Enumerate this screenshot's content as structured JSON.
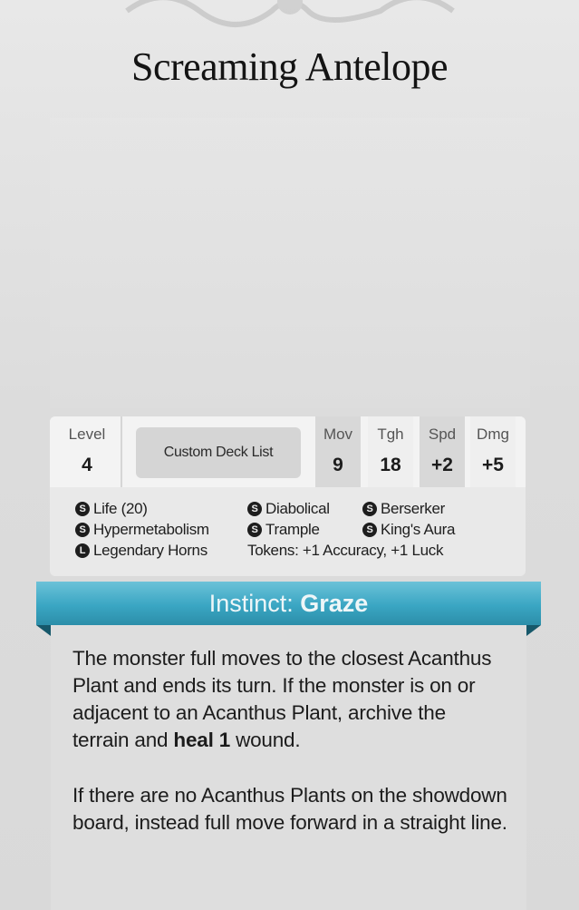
{
  "title": "Screaming Antelope",
  "stats": {
    "level_label": "Level",
    "level_value": "4",
    "deck_button": "Custom Deck List",
    "mov_label": "Mov",
    "mov_value": "9",
    "tgh_label": "Tgh",
    "tgh_value": "18",
    "spd_label": "Spd",
    "spd_value": "+2",
    "dmg_label": "Dmg",
    "dmg_value": "+5"
  },
  "traits": [
    {
      "badge": "S",
      "text": "Life (20)"
    },
    {
      "badge": "S",
      "text": "Diabolical"
    },
    {
      "badge": "S",
      "text": "Berserker"
    },
    {
      "badge": "S",
      "text": "Hypermetabolism"
    },
    {
      "badge": "S",
      "text": "Trample"
    },
    {
      "badge": "S",
      "text": "King's Aura"
    },
    {
      "badge": "L",
      "text": "Legendary Horns"
    }
  ],
  "tokens_text": "Tokens: +1 Accuracy, +1 Luck",
  "instinct": {
    "prefix": "Instinct:",
    "name": "Graze"
  },
  "body": {
    "p1_a": "The monster full moves to the closest Acanthus Plant and ends its turn. If the monster is on or adjacent to an Acanthus Plant, archive the terrain and ",
    "p1_bold": "heal 1",
    "p1_b": " wound.",
    "p2": "If there are no Acanthus Plants on the showdown board, instead full move forward in a straight line."
  },
  "colors": {
    "banner": "#3aa6c3",
    "banner_fold": "#16586a",
    "panel": "#dedede"
  }
}
